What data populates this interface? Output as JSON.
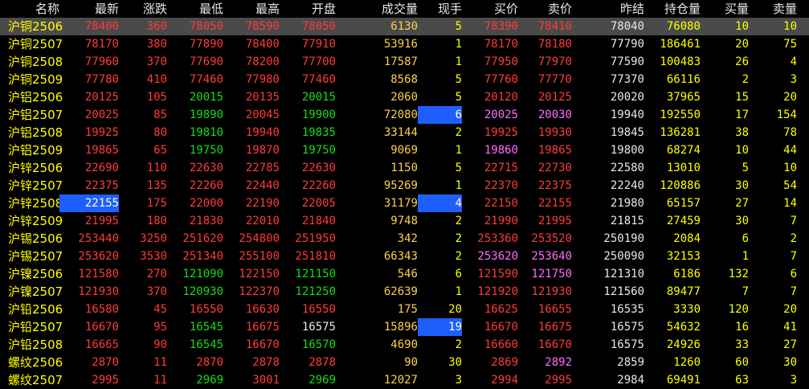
{
  "colors": {
    "up_red": "#ff3b3b",
    "down_green": "#16dd16",
    "neutral_white": "#e8e8e8",
    "volume_yellow": "#ffff00",
    "oi_gold": "#ffd04a",
    "magenta": "#ff6cff",
    "highlight_blue": "#1f5fff",
    "selected_row_gray": "#4a4a4a",
    "background": "#000000"
  },
  "headers": {
    "name": "名称",
    "latest": "最新",
    "change": "涨跌",
    "low": "最低",
    "high": "最高",
    "open": "开盘",
    "volume": "成交量",
    "now": "现手",
    "bid": "买价",
    "ask": "卖价",
    "prev": "昨结",
    "oi": "持仓量",
    "bidv": "买量",
    "askv": "卖量"
  },
  "rows": [
    {
      "name": "沪铜2506",
      "latest": "78400",
      "change": "360",
      "low": "78050",
      "high": "78590",
      "open": "78050",
      "volume": "6130",
      "now": "5",
      "bid": "78390",
      "ask": "78410",
      "prev": "78040",
      "oi": "76080",
      "bidv": "10",
      "askv": "10"
    },
    {
      "name": "沪铜2507",
      "latest": "78170",
      "change": "380",
      "low": "77890",
      "high": "78400",
      "open": "77910",
      "volume": "53916",
      "now": "1",
      "bid": "78170",
      "ask": "78180",
      "prev": "77790",
      "oi": "186461",
      "bidv": "20",
      "askv": "75"
    },
    {
      "name": "沪铜2508",
      "latest": "77960",
      "change": "370",
      "low": "77690",
      "high": "78200",
      "open": "77700",
      "volume": "17587",
      "now": "1",
      "bid": "77950",
      "ask": "77970",
      "prev": "77590",
      "oi": "100483",
      "bidv": "26",
      "askv": "4"
    },
    {
      "name": "沪铜2509",
      "latest": "77780",
      "change": "410",
      "low": "77460",
      "high": "77980",
      "open": "77460",
      "volume": "8568",
      "now": "5",
      "bid": "77760",
      "ask": "77770",
      "prev": "77370",
      "oi": "66116",
      "bidv": "2",
      "askv": "3"
    },
    {
      "name": "沪铝2506",
      "latest": "20125",
      "change": "105",
      "low": "20015",
      "high": "20135",
      "open": "20015",
      "volume": "2060",
      "now": "5",
      "bid": "20120",
      "ask": "20125",
      "prev": "20020",
      "oi": "37965",
      "bidv": "15",
      "askv": "20"
    },
    {
      "name": "沪铝2507",
      "latest": "20025",
      "change": "85",
      "low": "19890",
      "high": "20045",
      "open": "19900",
      "volume": "72080",
      "now": "6",
      "bid": "20025",
      "ask": "20030",
      "prev": "19940",
      "oi": "192550",
      "bidv": "17",
      "askv": "154"
    },
    {
      "name": "沪铝2508",
      "latest": "19925",
      "change": "80",
      "low": "19810",
      "high": "19940",
      "open": "19835",
      "volume": "33144",
      "now": "2",
      "bid": "19925",
      "ask": "19930",
      "prev": "19845",
      "oi": "136281",
      "bidv": "38",
      "askv": "78"
    },
    {
      "name": "沪铝2509",
      "latest": "19865",
      "change": "65",
      "low": "19750",
      "high": "19870",
      "open": "19750",
      "volume": "9069",
      "now": "1",
      "bid": "19860",
      "ask": "19865",
      "prev": "19800",
      "oi": "68274",
      "bidv": "10",
      "askv": "44"
    },
    {
      "name": "沪锌2506",
      "latest": "22690",
      "change": "110",
      "low": "22630",
      "high": "22785",
      "open": "22630",
      "volume": "1150",
      "now": "5",
      "bid": "22715",
      "ask": "22730",
      "prev": "22580",
      "oi": "13010",
      "bidv": "5",
      "askv": "10"
    },
    {
      "name": "沪锌2507",
      "latest": "22375",
      "change": "135",
      "low": "22260",
      "high": "22440",
      "open": "22260",
      "volume": "95269",
      "now": "1",
      "bid": "22370",
      "ask": "22375",
      "prev": "22240",
      "oi": "120886",
      "bidv": "30",
      "askv": "54"
    },
    {
      "name": "沪锌2508",
      "latest": "22155",
      "change": "175",
      "low": "22000",
      "high": "22190",
      "open": "22005",
      "volume": "31179",
      "now": "4",
      "bid": "22150",
      "ask": "22155",
      "prev": "21980",
      "oi": "65157",
      "bidv": "27",
      "askv": "14"
    },
    {
      "name": "沪锌2509",
      "latest": "21995",
      "change": "180",
      "low": "21830",
      "high": "22010",
      "open": "21840",
      "volume": "9748",
      "now": "2",
      "bid": "21990",
      "ask": "21995",
      "prev": "21815",
      "oi": "27459",
      "bidv": "30",
      "askv": "7"
    },
    {
      "name": "沪锡2506",
      "latest": "253440",
      "change": "3250",
      "low": "251620",
      "high": "254800",
      "open": "251950",
      "volume": "342",
      "now": "2",
      "bid": "253360",
      "ask": "253520",
      "prev": "250190",
      "oi": "2084",
      "bidv": "6",
      "askv": "2"
    },
    {
      "name": "沪锡2507",
      "latest": "253620",
      "change": "3530",
      "low": "251340",
      "high": "255100",
      "open": "251810",
      "volume": "66343",
      "now": "2",
      "bid": "253620",
      "ask": "253640",
      "prev": "250090",
      "oi": "32153",
      "bidv": "1",
      "askv": "7"
    },
    {
      "name": "沪镍2506",
      "latest": "121580",
      "change": "270",
      "low": "121090",
      "high": "122150",
      "open": "121150",
      "volume": "546",
      "now": "6",
      "bid": "121590",
      "ask": "121750",
      "prev": "121310",
      "oi": "6186",
      "bidv": "132",
      "askv": "6"
    },
    {
      "name": "沪镍2507",
      "latest": "121930",
      "change": "370",
      "low": "120930",
      "high": "122370",
      "open": "121250",
      "volume": "62639",
      "now": "1",
      "bid": "121920",
      "ask": "121930",
      "prev": "121560",
      "oi": "89477",
      "bidv": "7",
      "askv": "7"
    },
    {
      "name": "沪铅2506",
      "latest": "16580",
      "change": "45",
      "low": "16550",
      "high": "16630",
      "open": "16550",
      "volume": "175",
      "now": "20",
      "bid": "16625",
      "ask": "16655",
      "prev": "16535",
      "oi": "3330",
      "bidv": "120",
      "askv": "20"
    },
    {
      "name": "沪铅2507",
      "latest": "16670",
      "change": "95",
      "low": "16545",
      "high": "16675",
      "open": "16575",
      "volume": "15896",
      "now": "19",
      "bid": "16670",
      "ask": "16675",
      "prev": "16575",
      "oi": "54632",
      "bidv": "16",
      "askv": "41"
    },
    {
      "name": "沪铅2508",
      "latest": "16665",
      "change": "90",
      "low": "16545",
      "high": "16670",
      "open": "16570",
      "volume": "4690",
      "now": "2",
      "bid": "16660",
      "ask": "16670",
      "prev": "16575",
      "oi": "24926",
      "bidv": "33",
      "askv": "27"
    },
    {
      "name": "螺纹2506",
      "latest": "2870",
      "change": "11",
      "low": "2870",
      "high": "2878",
      "open": "2878",
      "volume": "90",
      "now": "30",
      "bid": "2869",
      "ask": "2892",
      "prev": "2859",
      "oi": "1260",
      "bidv": "60",
      "askv": "30"
    },
    {
      "name": "螺纹2507",
      "latest": "2995",
      "change": "11",
      "low": "2969",
      "high": "3001",
      "open": "2969",
      "volume": "12027",
      "now": "3",
      "bid": "2994",
      "ask": "2995",
      "prev": "2984",
      "oi": "69491",
      "bidv": "63",
      "askv": "3"
    }
  ]
}
